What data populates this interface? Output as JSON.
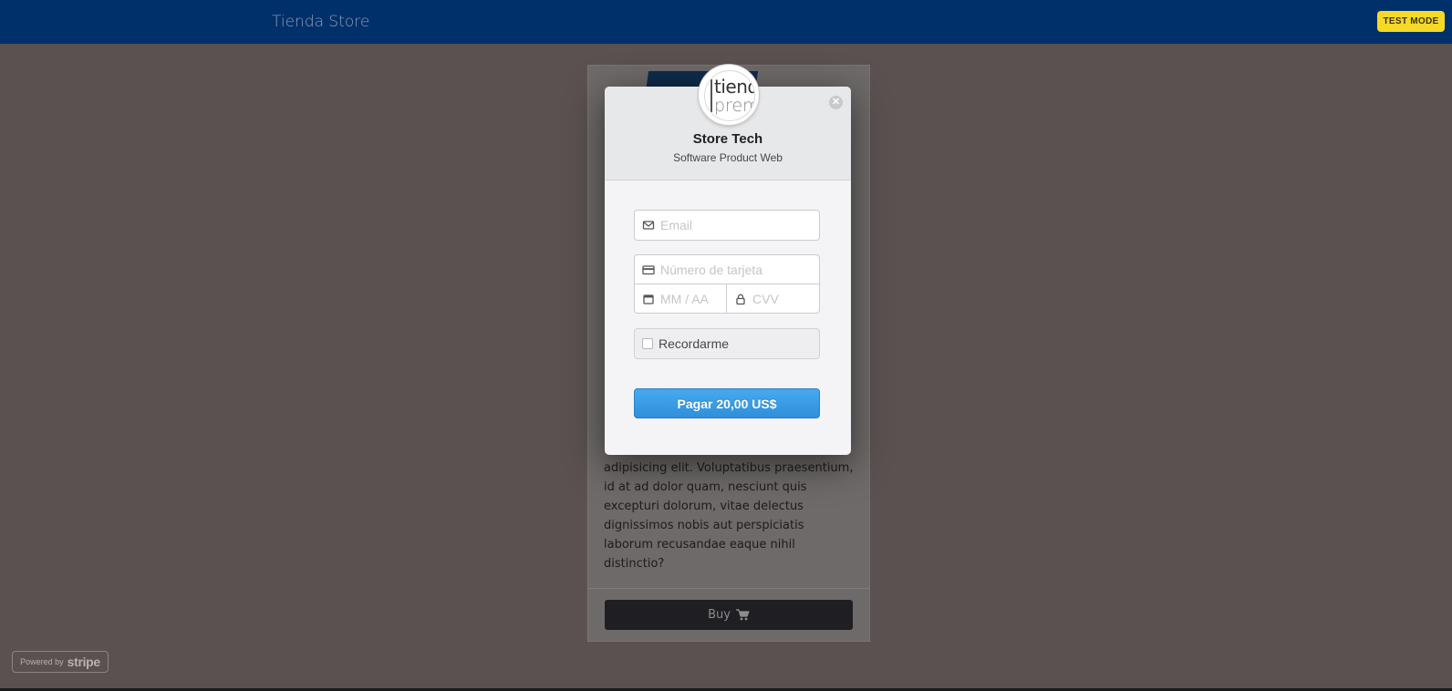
{
  "navbar": {
    "brand": "Tienda Store",
    "test_mode": "TEST MODE"
  },
  "product_card": {
    "description": "Lorem ipsum dolor sit amet consectetur, adipisicing elit. Voluptatibus praesentium, id at ad dolor quam, nesciunt quis excepturi dolorum, vitae delectus dignissimos nobis aut perspiciatis laborum recusandae eaque nihil distinctio?",
    "buy_label": "Buy"
  },
  "powered_by": {
    "prefix": "Powered by",
    "brand": "stripe"
  },
  "checkout": {
    "logo_line1": "tiend",
    "logo_line2": "prem",
    "title": "Store Tech",
    "subtitle": "Software Product Web",
    "email_placeholder": "Email",
    "email_value": "",
    "card_placeholder": "Número de tarjeta",
    "card_value": "",
    "expiry_placeholder": "MM / AA",
    "expiry_value": "",
    "cvv_placeholder": "CVV",
    "cvv_value": "",
    "remember_label": "Recordarme",
    "remember_checked": false,
    "pay_label": "Pagar 20,00 US$"
  },
  "icons": {
    "close": "close-icon",
    "email": "envelope-icon",
    "card": "credit-card-icon",
    "expiry": "calendar-icon",
    "cvv": "lock-icon",
    "cart": "shopping-cart-icon"
  },
  "colors": {
    "navbar": "#00306a",
    "test_mode_badge": "#f6d925",
    "pay_button": "#3a9be4",
    "overlay": "#5a5150"
  }
}
